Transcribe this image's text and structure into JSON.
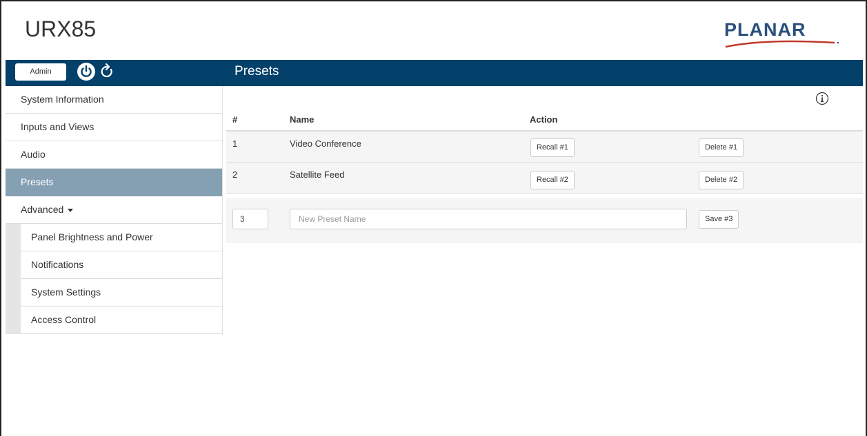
{
  "app": {
    "title": "URX85",
    "logo_text": "PLANAR"
  },
  "topbar": {
    "admin_label": "Admin",
    "page_title": "Presets"
  },
  "sidebar": {
    "items": [
      {
        "label": "System Information"
      },
      {
        "label": "Inputs and Views"
      },
      {
        "label": "Audio"
      },
      {
        "label": "Presets",
        "active": true
      },
      {
        "label": "Advanced"
      }
    ],
    "advanced_items": [
      {
        "label": "Panel Brightness and Power"
      },
      {
        "label": "Notifications"
      },
      {
        "label": "System Settings"
      },
      {
        "label": "Access Control"
      }
    ]
  },
  "table": {
    "headers": {
      "num": "#",
      "name": "Name",
      "action": "Action"
    },
    "rows": [
      {
        "num": "1",
        "name": "Video Conference",
        "recall": "Recall #1",
        "delete": "Delete #1"
      },
      {
        "num": "2",
        "name": "Satellite Feed",
        "recall": "Recall #2",
        "delete": "Delete #2"
      }
    ],
    "new_row": {
      "num_value": "3",
      "name_placeholder": "New Preset Name",
      "save_label": "Save #3"
    }
  },
  "colors": {
    "topbar": "#03406a",
    "active_item": "#86a0b3",
    "logo": "#2a4f7e",
    "logo_swoosh": "#c0392b"
  }
}
